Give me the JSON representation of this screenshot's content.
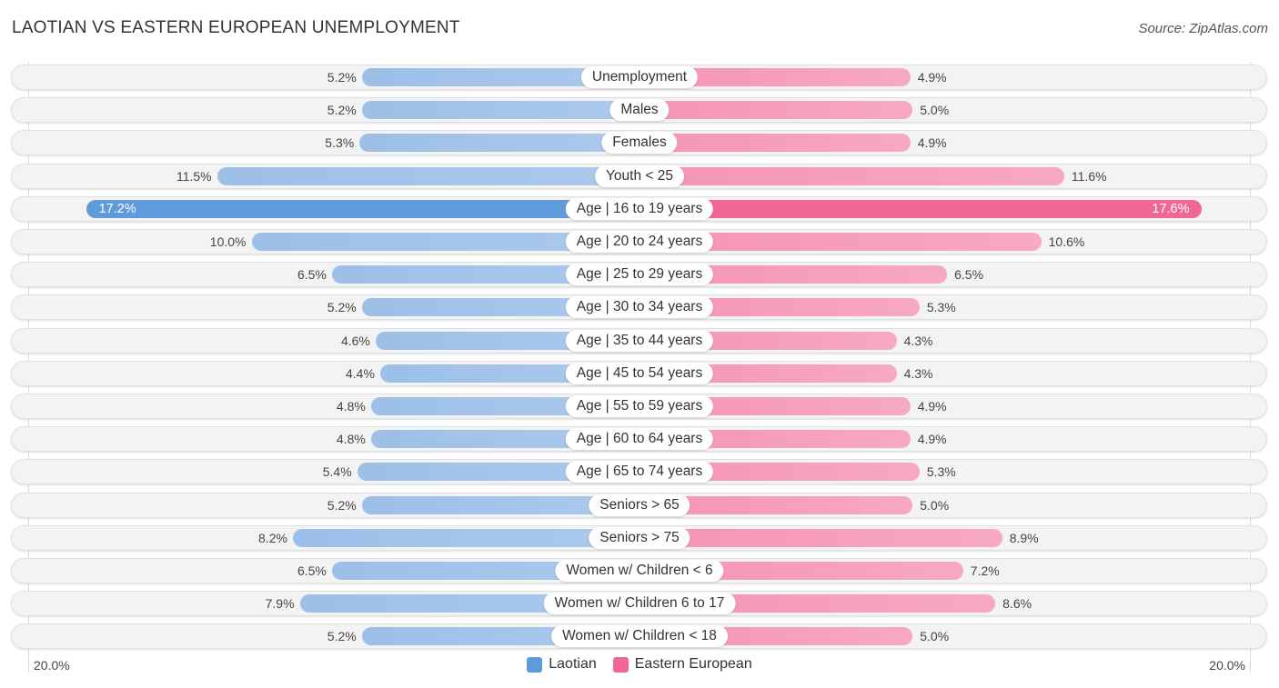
{
  "header": {
    "title": "LAOTIAN VS EASTERN EUROPEAN UNEMPLOYMENT",
    "source": "Source: ZipAtlas.com"
  },
  "chart_data": {
    "type": "bar",
    "orientation": "horizontal-diverging",
    "title": "LAOTIAN VS EASTERN EUROPEAN UNEMPLOYMENT",
    "categories": [
      "Unemployment",
      "Males",
      "Females",
      "Youth < 25",
      "Age | 16 to 19 years",
      "Age | 20 to 24 years",
      "Age | 25 to 29 years",
      "Age | 30 to 34 years",
      "Age | 35 to 44 years",
      "Age | 45 to 54 years",
      "Age | 55 to 59 years",
      "Age | 60 to 64 years",
      "Age | 65 to 74 years",
      "Seniors > 65",
      "Seniors > 75",
      "Women w/ Children < 6",
      "Women w/ Children 6 to 17",
      "Women w/ Children < 18"
    ],
    "series": [
      {
        "name": "Laotian",
        "color": "#5f9bdb",
        "side": "left",
        "values": [
          5.2,
          5.2,
          5.3,
          11.5,
          17.2,
          10.0,
          6.5,
          5.2,
          4.6,
          4.4,
          4.8,
          4.8,
          5.4,
          5.2,
          8.2,
          6.5,
          7.9,
          5.2
        ],
        "labels": [
          "5.2%",
          "5.2%",
          "5.3%",
          "11.5%",
          "17.2%",
          "10.0%",
          "6.5%",
          "5.2%",
          "4.6%",
          "4.4%",
          "4.8%",
          "4.8%",
          "5.4%",
          "5.2%",
          "8.2%",
          "6.5%",
          "7.9%",
          "5.2%"
        ]
      },
      {
        "name": "Eastern European",
        "color": "#f06793",
        "side": "right",
        "values": [
          4.9,
          5.0,
          4.9,
          11.6,
          17.6,
          10.6,
          6.5,
          5.3,
          4.3,
          4.3,
          4.9,
          4.9,
          5.3,
          5.0,
          8.9,
          7.2,
          8.6,
          5.0
        ],
        "labels": [
          "4.9%",
          "5.0%",
          "4.9%",
          "11.6%",
          "17.6%",
          "10.6%",
          "6.5%",
          "5.3%",
          "4.3%",
          "4.3%",
          "4.9%",
          "4.9%",
          "5.3%",
          "5.0%",
          "8.9%",
          "7.2%",
          "8.6%",
          "5.0%"
        ]
      }
    ],
    "highlight_index": 4,
    "axis": {
      "left_label": "20.0%",
      "right_label": "20.0%",
      "max": 20.0
    },
    "legend": {
      "position": "bottom-center",
      "items": [
        "Laotian",
        "Eastern European"
      ]
    }
  }
}
